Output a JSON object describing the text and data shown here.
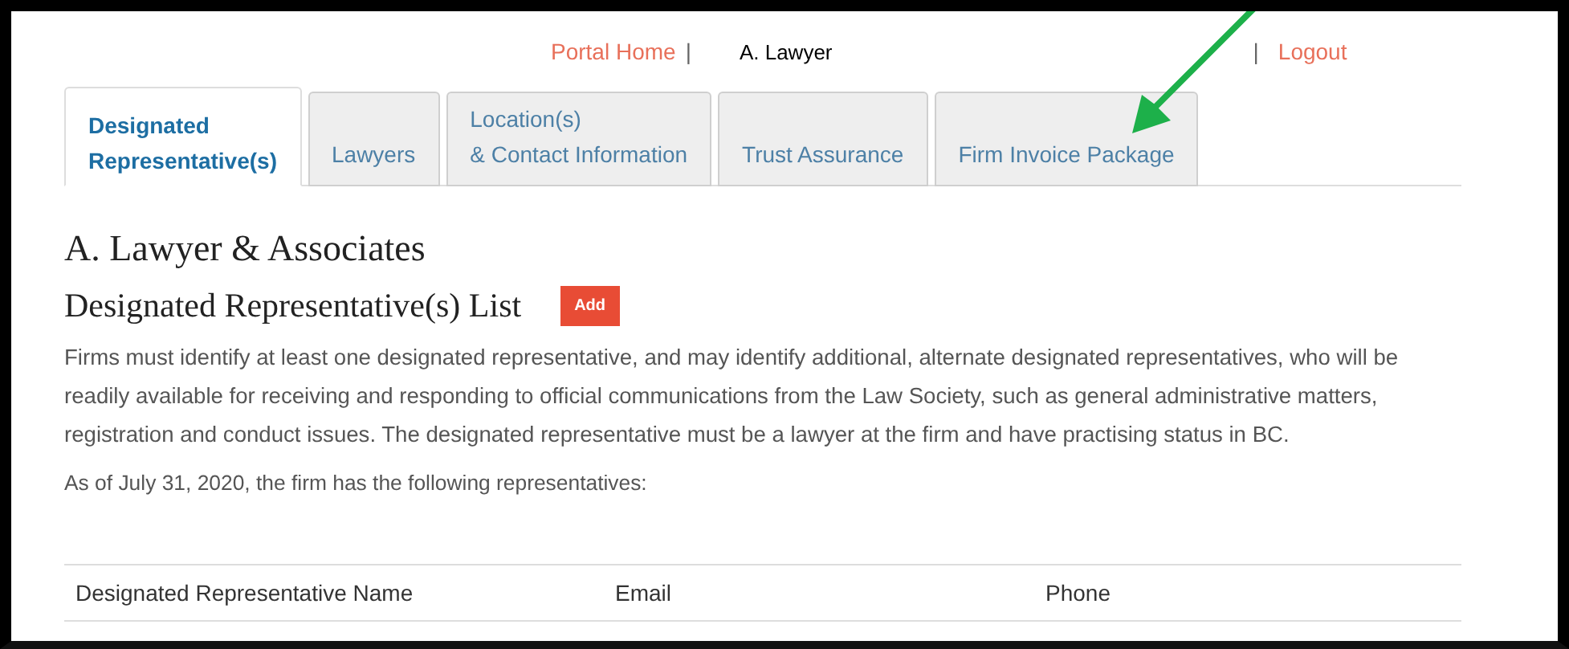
{
  "top_links": [
    {
      "label": "Portal Home",
      "kind": "link"
    },
    {
      "label": "|",
      "kind": "separator"
    },
    {
      "label": "A. Lawyer",
      "kind": "user"
    },
    {
      "label": "|",
      "kind": "separator"
    },
    {
      "label": "Logout",
      "kind": "link"
    }
  ],
  "tabs": [
    {
      "lines": [
        "Designated",
        "Representative(s)"
      ],
      "selected": true
    },
    {
      "lines": [
        "Lawyers"
      ],
      "selected": false
    },
    {
      "lines": [
        "Location(s)",
        "& Contact Information"
      ],
      "selected": false
    },
    {
      "lines": [
        "Trust Assurance"
      ],
      "selected": false
    },
    {
      "lines": [
        "Firm Invoice Package"
      ],
      "selected": false
    }
  ],
  "firm_name": "A. Lawyer & Associates",
  "section_title": "Designated Representative(s) List",
  "add_button": "Add",
  "description": "Firms must identify at least one designated representative, and may identify additional, alternate designated representatives, who will be readily available for receiving and responding to official communications from the Law Society, such as general administrative matters, registration and conduct issues. The designated representative must be a lawyer at the firm and have practising status in BC.",
  "as_of": "As of July 31, 2020, the firm has the following representatives:",
  "table": {
    "columns": [
      "Designated Representative Name",
      "Email",
      "Phone"
    ]
  }
}
